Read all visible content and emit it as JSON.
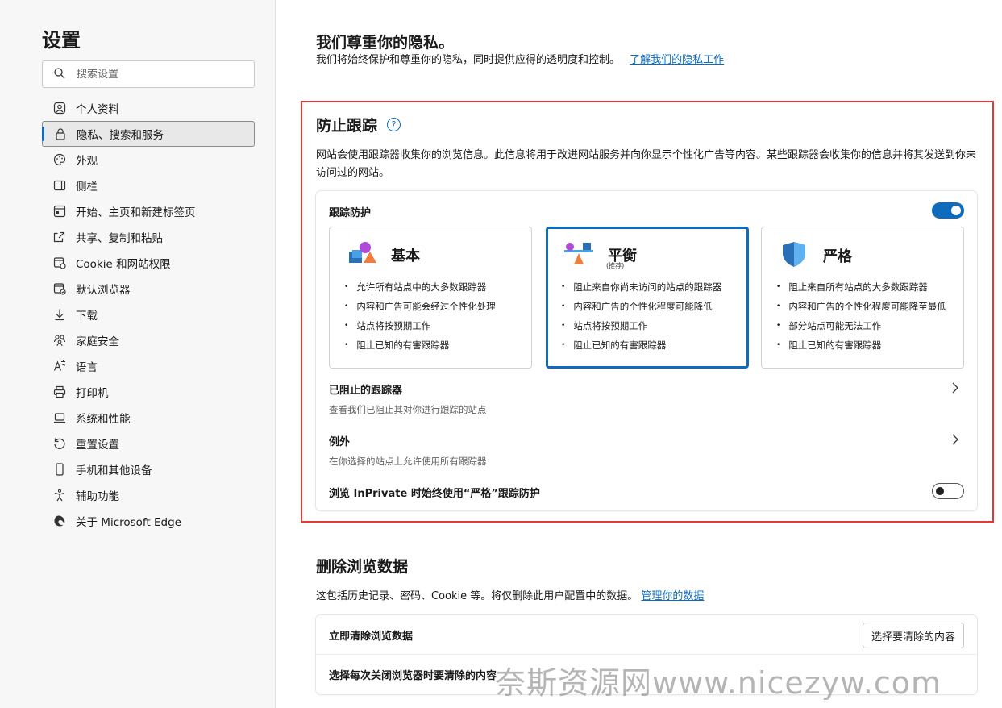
{
  "sidebar": {
    "title": "设置",
    "search_placeholder": "搜索设置",
    "items": [
      {
        "label": "个人资料",
        "icon": "profile-icon"
      },
      {
        "label": "隐私、搜索和服务",
        "icon": "lock-icon",
        "active": true
      },
      {
        "label": "外观",
        "icon": "palette-icon"
      },
      {
        "label": "侧栏",
        "icon": "sidebar-icon"
      },
      {
        "label": "开始、主页和新建标签页",
        "icon": "home-tab-icon"
      },
      {
        "label": "共享、复制和粘贴",
        "icon": "share-icon"
      },
      {
        "label": "Cookie 和网站权限",
        "icon": "site-permissions-icon"
      },
      {
        "label": "默认浏览器",
        "icon": "default-browser-icon"
      },
      {
        "label": "下载",
        "icon": "download-icon"
      },
      {
        "label": "家庭安全",
        "icon": "family-icon"
      },
      {
        "label": "语言",
        "icon": "language-icon"
      },
      {
        "label": "打印机",
        "icon": "printer-icon"
      },
      {
        "label": "系统和性能",
        "icon": "laptop-icon"
      },
      {
        "label": "重置设置",
        "icon": "reset-icon"
      },
      {
        "label": "手机和其他设备",
        "icon": "phone-icon"
      },
      {
        "label": "辅助功能",
        "icon": "accessibility-icon"
      },
      {
        "label": "关于 Microsoft Edge",
        "icon": "edge-icon"
      }
    ]
  },
  "privacy": {
    "title": "我们尊重你的隐私。",
    "desc": "我们将始终保护和尊重你的隐私，同时提供应得的透明度和控制。",
    "link": "了解我们的隐私工作"
  },
  "tracking": {
    "title": "防止跟踪",
    "desc": "网站会使用跟踪器收集你的浏览信息。此信息将用于改进网站服务并向你显示个性化广告等内容。某些跟踪器会收集你的信息并将其发送到你未访问过的网站。",
    "toggle_label": "跟踪防护",
    "toggle_on": true,
    "levels": [
      {
        "name": "基本",
        "sub": "",
        "icon": "basic-shapes-icon",
        "selected": false,
        "bullets": [
          "允许所有站点中的大多数跟踪器",
          "内容和广告可能会经过个性化处理",
          "站点将按预期工作",
          "阻止已知的有害跟踪器"
        ]
      },
      {
        "name": "平衡",
        "sub": "(推荐)",
        "icon": "balance-scale-icon",
        "selected": true,
        "bullets": [
          "阻止来自你尚未访问的站点的跟踪器",
          "内容和广告的个性化程度可能降低",
          "站点将按预期工作",
          "阻止已知的有害跟踪器"
        ]
      },
      {
        "name": "严格",
        "sub": "",
        "icon": "shield-icon",
        "selected": false,
        "bullets": [
          "阻止来自所有站点的大多数跟踪器",
          "内容和广告的个性化程度可能降至最低",
          "部分站点可能无法工作",
          "阻止已知的有害跟踪器"
        ]
      }
    ],
    "blocked": {
      "title": "已阻止的跟踪器",
      "sub": "查看我们已阻止其对你进行跟踪的站点"
    },
    "exceptions": {
      "title": "例外",
      "sub": "在你选择的站点上允许使用所有跟踪器"
    },
    "inprivate": {
      "label": "浏览 InPrivate 时始终使用“严格”跟踪防护",
      "toggle_on": false
    }
  },
  "clear": {
    "title": "删除浏览数据",
    "desc": "这包括历史记录、密码、Cookie 等。将仅删除此用户配置中的数据。",
    "link": "管理你的数据",
    "now_label": "立即清除浏览数据",
    "button": "选择要清除的内容",
    "on_close_label": "选择每次关闭浏览器时要清除的内容"
  },
  "watermark": "奈斯资源网www.nicezyw.com",
  "colors": {
    "accent": "#0f6cbd",
    "highlight_border": "#e53935"
  }
}
